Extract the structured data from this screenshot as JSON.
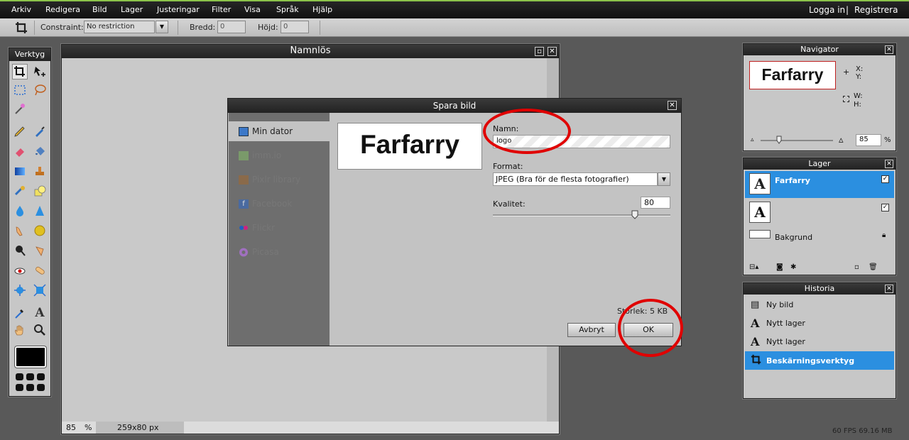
{
  "menubar": {
    "items": [
      "Arkiv",
      "Redigera",
      "Bild",
      "Lager",
      "Justeringar",
      "Filter",
      "Visa",
      "Språk",
      "Hjälp"
    ],
    "login": "Logga in",
    "separator": "|",
    "register": "Registrera"
  },
  "options": {
    "constraint_label": "Constraint:",
    "constraint_value": "No restriction",
    "width_label": "Bredd:",
    "width_value": "0",
    "height_label": "Höjd:",
    "height_value": "0"
  },
  "toolbox": {
    "title": "Verktyg"
  },
  "canvas": {
    "title": "Namnlös",
    "zoom_value": "85",
    "zoom_unit": "%",
    "dimensions": "259x80 px"
  },
  "dialog": {
    "title": "Spara bild",
    "services": [
      "Min dator",
      "imm.io",
      "Pixlr library",
      "Facebook",
      "Flickr",
      "Picasa"
    ],
    "preview_text": "Farfarry",
    "name_label": "Namn:",
    "name_value": "logo",
    "format_label": "Format:",
    "format_value": "JPEG (Bra för de flesta fotografier)",
    "quality_label": "Kvalitet:",
    "quality_value": "80",
    "quality_fraction": 0.8,
    "size_text": "Storlek: 5 KB",
    "cancel_label": "Avbryt",
    "ok_label": "OK"
  },
  "navigator": {
    "title": "Navigator",
    "preview_text": "Farfarry",
    "x_label": "X:",
    "y_label": "Y:",
    "w_label": "W:",
    "h_label": "H:",
    "zoom_value": "85",
    "zoom_unit": "%"
  },
  "layers": {
    "title": "Lager",
    "items": [
      "Farfarry",
      "",
      "Bakgrund"
    ]
  },
  "history": {
    "title": "Historia",
    "items": [
      "Ny bild",
      "Nytt lager",
      "Nytt lager",
      "Beskärningsverktyg"
    ]
  },
  "status": {
    "fps": "60 FPS 69.16 MB"
  },
  "colors": {
    "accent_blue": "#2b8fe0",
    "annotation_red": "#e00000",
    "menubar": "#1a1a1a"
  }
}
